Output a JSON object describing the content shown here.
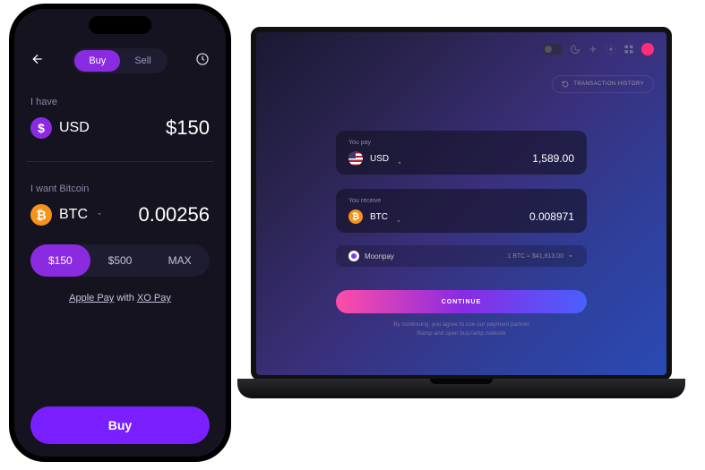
{
  "mobile": {
    "tabs": {
      "buy": "Buy",
      "sell": "Sell"
    },
    "have": {
      "label": "I have",
      "currency": "USD",
      "amount": "$150"
    },
    "want": {
      "label": "I want Bitcoin",
      "currency": "BTC",
      "amount": "0.00256"
    },
    "presets": {
      "a": "$150",
      "b": "$500",
      "c": "MAX"
    },
    "payline": {
      "apple": "Apple Pay",
      "with": " with ",
      "xo": "XO Pay"
    },
    "buy_label": "Buy"
  },
  "desktop": {
    "tx_history": "TRANSACTION HISTORY",
    "pay": {
      "label": "You pay",
      "currency": "USD",
      "amount": "1,589.00"
    },
    "receive": {
      "label": "You receive",
      "currency": "BTC",
      "amount": "0.008971"
    },
    "provider": {
      "name": "Moonpay",
      "rate": "1 BTC ≈ $41,813.00"
    },
    "continue": "CONTINUE",
    "disclaimer1": "By continuing, you agree to use our payment partner",
    "disclaimer2": "Ramp and open buy.ramp.network"
  }
}
